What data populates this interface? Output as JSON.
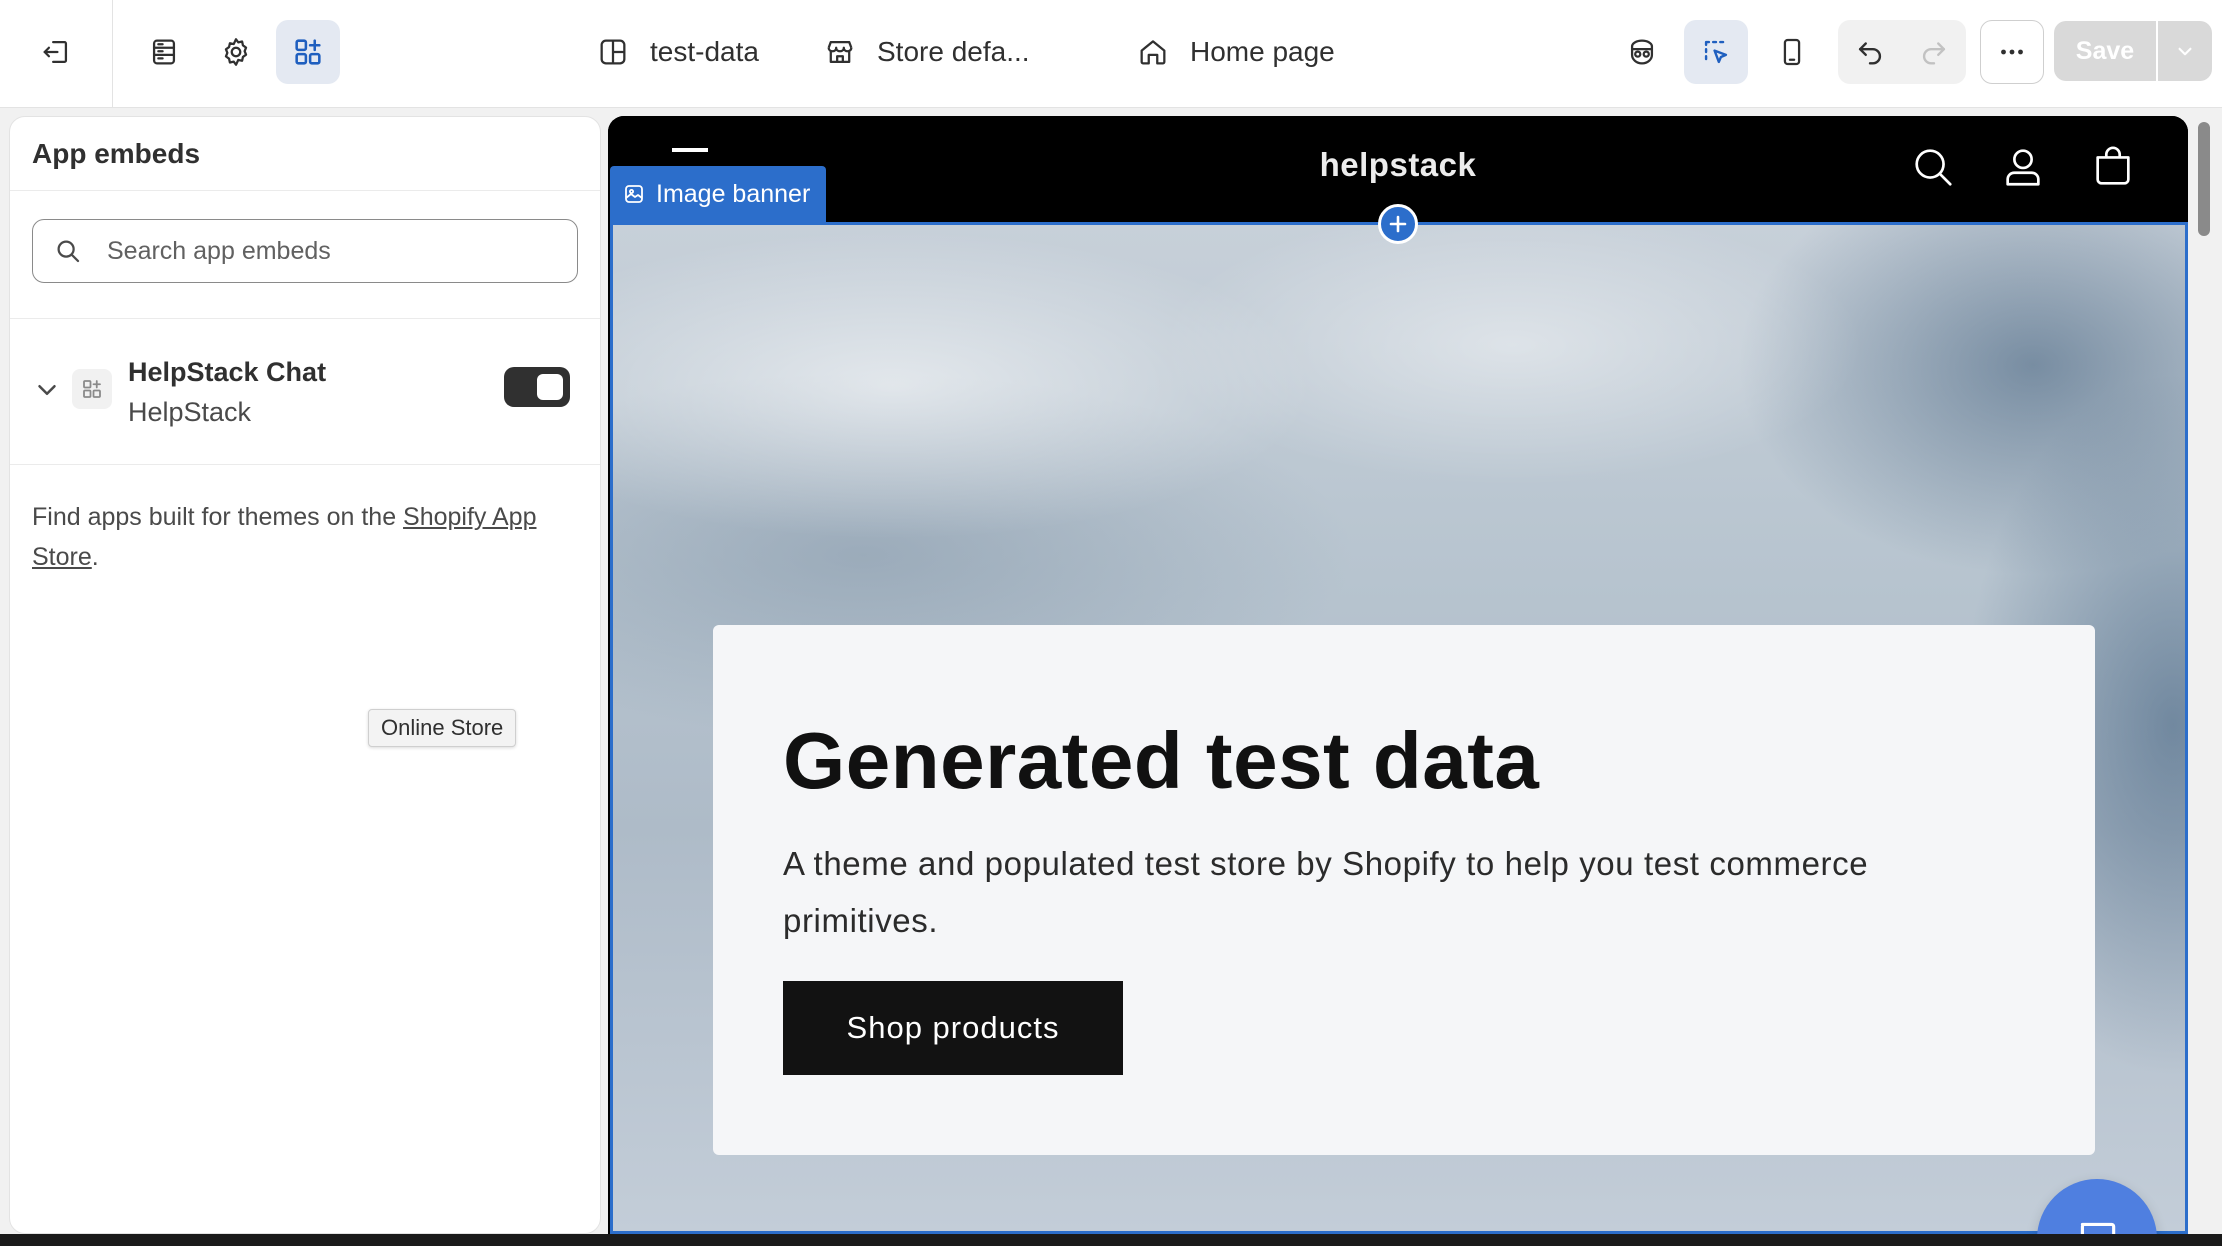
{
  "topbar": {
    "exit_icon": "exit-icon",
    "sections_icon": "sections-icon",
    "settings_icon": "gear-icon",
    "apps_icon": "app-embeds-icon",
    "theme_label": "test-data",
    "store_label": "Store defa...",
    "page_label": "Home page",
    "save_label": "Save"
  },
  "panel": {
    "title": "App embeds",
    "search_placeholder": "Search app embeds",
    "embed": {
      "title": "HelpStack Chat",
      "subtitle": "HelpStack",
      "enabled": true
    },
    "help_prefix": "Find apps built for themes on the ",
    "help_link": "Shopify App Store",
    "help_suffix": ".",
    "tooltip": "Online Store"
  },
  "preview": {
    "store_name": "helpstack",
    "section_tag": "Image banner",
    "hero_title": "Generated test data",
    "hero_subtitle": "A theme and populated test store by Shopify to help you test commerce primitives.",
    "hero_button": "Shop products"
  },
  "colors": {
    "accent": "#2c6ecb",
    "chat_bubble": "#4f7fe0",
    "toggle_on": "#303030"
  }
}
